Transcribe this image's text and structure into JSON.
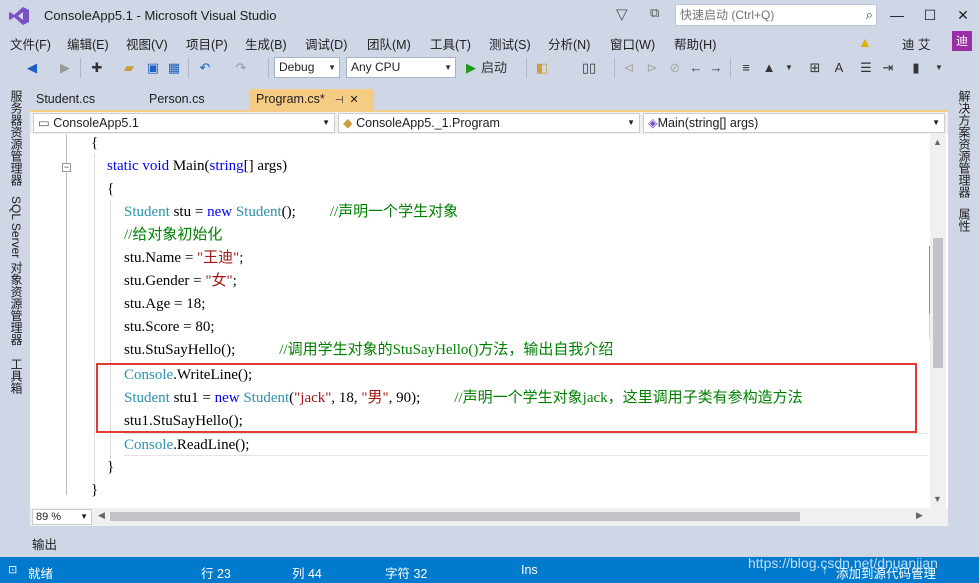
{
  "window": {
    "title": "ConsoleApp5.1 - Microsoft Visual Studio",
    "quick_launch_placeholder": "快速启动 (Ctrl+Q)",
    "minimize": "—",
    "maximize": "☐",
    "close": "✕"
  },
  "menu": [
    "文件(F)",
    "编辑(E)",
    "视图(V)",
    "项目(P)",
    "生成(B)",
    "调试(D)",
    "团队(M)",
    "工具(T)",
    "测试(S)",
    "分析(N)",
    "窗口(W)",
    "帮助(H)"
  ],
  "user": {
    "name": "迪 艾",
    "avatar": "迪"
  },
  "toolbar": {
    "config": "Debug",
    "platform": "Any CPU",
    "start_label": "启动"
  },
  "left_tool_windows": [
    "服务器资源管理器",
    "SQL Server 对象资源管理器",
    "工具箱"
  ],
  "right_tool_windows": [
    "解决方案资源管理器",
    "属性"
  ],
  "tabs": [
    {
      "label": "Student.cs"
    },
    {
      "label": "Person.cs"
    },
    {
      "label": "Program.cs*"
    }
  ],
  "nav": {
    "project": "ConsoleApp5.1",
    "class": "ConsoleApp5._1.Program",
    "member": "Main(string[] args)"
  },
  "code": {
    "l0": "{",
    "l1_kw": "static void",
    "l1_rest": " Main(",
    "l1_type": "string",
    "l1_end": "[] args)",
    "l2": "{",
    "l3_type": "Student",
    "l3_a": " stu = ",
    "l3_kw": "new",
    "l3_type2": " Student",
    "l3_b": "();",
    "l3_cm": "//声明一个学生对象",
    "l4_cm": "//给对象初始化",
    "l5_a": "stu.Name = ",
    "l5_s": "\"王迪\"",
    "l5_b": ";",
    "l6_a": "stu.Gender = ",
    "l6_s": "\"女\"",
    "l6_b": ";",
    "l7": "stu.Age = 18;",
    "l8": "stu.Score = 80;",
    "l9_a": "stu.StuSayHello();",
    "l9_cm": "//调用学生对象的StuSayHello()方法，输出自我介绍",
    "l10_type": "Console",
    "l10_a": ".WriteLine();",
    "l11_type": "Student",
    "l11_a": " stu1 = ",
    "l11_kw": "new",
    "l11_type2": " Student",
    "l11_b": "(",
    "l11_s1": "\"jack\"",
    "l11_c": ", 18, ",
    "l11_s2": "\"男\"",
    "l11_d": ", 90);",
    "l11_cm": "//声明一个学生对象jack，这里调用子类有参构造方法",
    "l12": "stu1.StuSayHello();",
    "l13_type": "Console",
    "l13_a": ".ReadLine();",
    "l14": "}",
    "l15": "}"
  },
  "zoom": "89 %",
  "output_tab": "输出",
  "status": {
    "ready": "就绪",
    "row": "行 23",
    "col": "列 44",
    "char": "字符 32",
    "mode": "Ins",
    "add_source": "添加到源代码管理"
  },
  "watermark": "https://blog.csdn.net/dnuanjian",
  "colors": {
    "accent": "#007acc",
    "highlight_box": "#e53935",
    "active_tab": "#f5cc84"
  }
}
